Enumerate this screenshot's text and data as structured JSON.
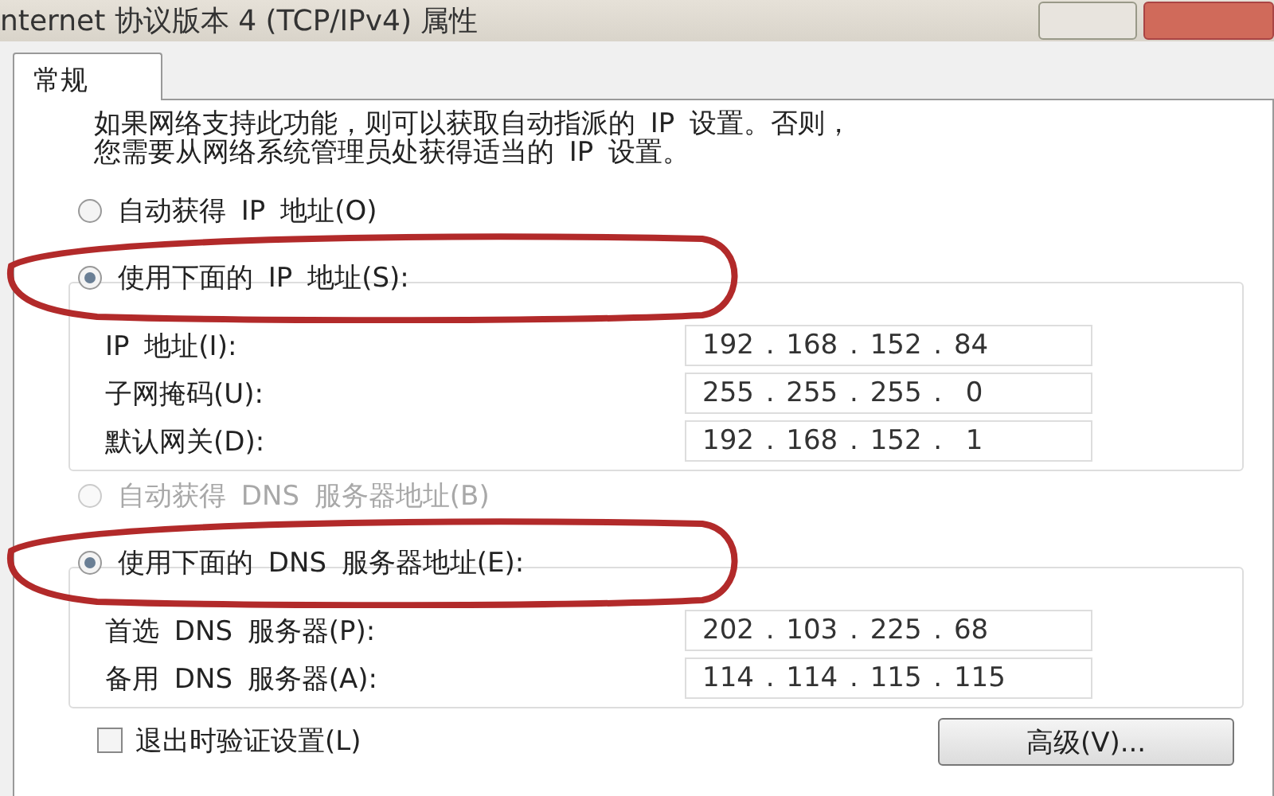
{
  "window": {
    "title": "nternet 协议版本 4 (TCP/IPv4) 属性"
  },
  "tabs": [
    {
      "label": "常规",
      "selected": true
    }
  ],
  "description": [
    "如果网络支持此功能，则可以获取自动指派的 IP 设置。否则，",
    "您需要从网络系统管理员处获得适当的 IP 设置。"
  ],
  "ip_mode": {
    "options": [
      {
        "label": "自动获得 IP 地址(O)",
        "selected": false,
        "disabled": false,
        "circled": false
      },
      {
        "label": "使用下面的 IP 地址(S):",
        "selected": true,
        "disabled": false,
        "circled": true
      }
    ],
    "fields": [
      {
        "label": "IP 地址(I):",
        "value": "192 . 168 . 152 . 84"
      },
      {
        "label": "子网掩码(U):",
        "value": "255 . 255 . 255 .  0"
      },
      {
        "label": "默认网关(D):",
        "value": "192 . 168 . 152 .  1"
      }
    ]
  },
  "dns_mode": {
    "options": [
      {
        "label": "自动获得 DNS 服务器地址(B)",
        "selected": false,
        "disabled": true,
        "circled": false
      },
      {
        "label": "使用下面的 DNS 服务器地址(E):",
        "selected": true,
        "disabled": false,
        "circled": true
      }
    ],
    "fields": [
      {
        "label": "首选 DNS 服务器(P):",
        "value": "202 . 103 . 225 . 68"
      },
      {
        "label": "备用 DNS 服务器(A):",
        "value": "114 . 114 . 115 . 115"
      }
    ]
  },
  "validate_on_exit": {
    "label": "退出时验证设置(L)",
    "checked": false
  },
  "buttons": [
    {
      "label": "高级(V)..."
    }
  ]
}
